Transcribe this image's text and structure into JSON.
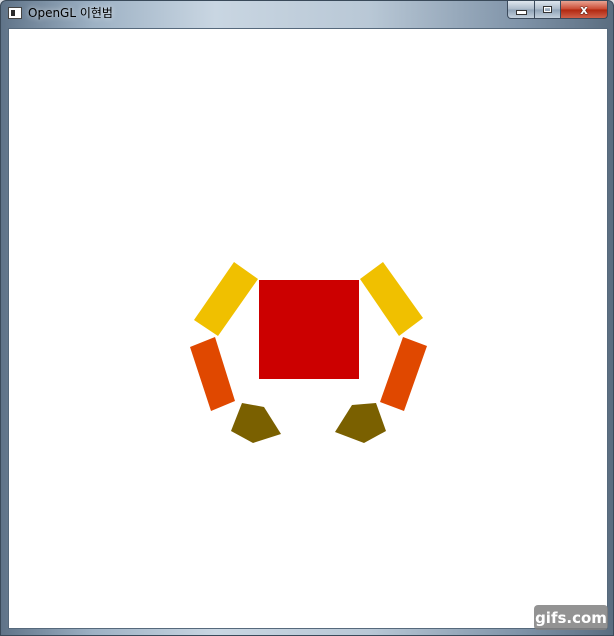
{
  "window": {
    "title": "OpenGL 이현범",
    "minimize_glyph": "",
    "maximize_glyph": "",
    "close_glyph": "x"
  },
  "watermark": {
    "text": "gifs.com"
  },
  "colors": {
    "body": "#CC0000",
    "upper_limb": "#F0C000",
    "lower_limb": "#E04800",
    "claw": "#7A6000",
    "canvas": "#FFFFFF"
  },
  "icons": [
    "app-window-icon",
    "minimize-icon",
    "maximize-icon",
    "close-icon"
  ]
}
